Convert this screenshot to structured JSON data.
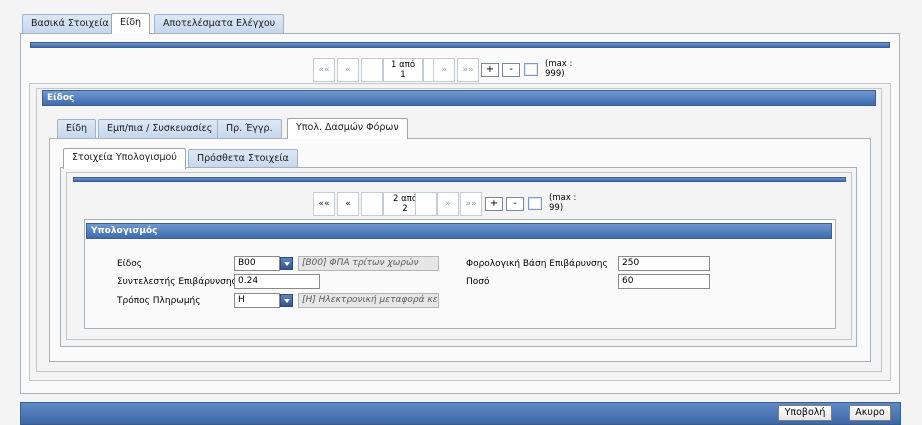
{
  "main_tabs": [
    "Βασικά Στοιχεία",
    "Είδη",
    "Αποτελέσματα Ελέγχου"
  ],
  "pager_top": {
    "first": "««",
    "prev": "«",
    "next": "»",
    "last": "»»",
    "count_line1": "1 από",
    "count_line2": "1",
    "add": "+",
    "remove": "-",
    "max_line1": "(max :",
    "max_line2": "999)"
  },
  "eidos_section": {
    "title": "Είδος"
  },
  "sub_tabs": [
    "Είδη",
    "Εμπ/πια / Συσκευασίες",
    "Πρ. Έγγρ.",
    "Υπολ. Δασμών Φόρων"
  ],
  "inner_tabs": [
    "Στοιχεία Υπολογισμού",
    "Πρόσθετα Στοιχεία"
  ],
  "pager_inner": {
    "first": "««",
    "prev": "«",
    "next": "»",
    "last": "»»",
    "count_line1": "2 από",
    "count_line2": "2",
    "add": "+",
    "remove": "-",
    "max_line1": "(max :",
    "max_line2": "99)"
  },
  "calc_section": {
    "title": "Υπολογισμός",
    "eidos_label": "Είδος",
    "eidos_code": "B00",
    "eidos_desc": "[B00] ΦΠΑ τρίτων χωρών",
    "rate_label": "Συντελεστής Επιβάρυνσης",
    "rate_value": "0.24",
    "payment_label": "Τρόπος Πληρωμής",
    "payment_code": "H",
    "payment_desc": "[H] Ηλεκτρονική μεταφορά κεφαλ",
    "tax_base_label": "Φορολογική Βάση Επιβάρυνσης",
    "tax_base_value": "250",
    "amount_label": "Ποσό",
    "amount_value": "60"
  },
  "footer": {
    "submit": "Υποβολή",
    "cancel": "Ακυρο"
  }
}
